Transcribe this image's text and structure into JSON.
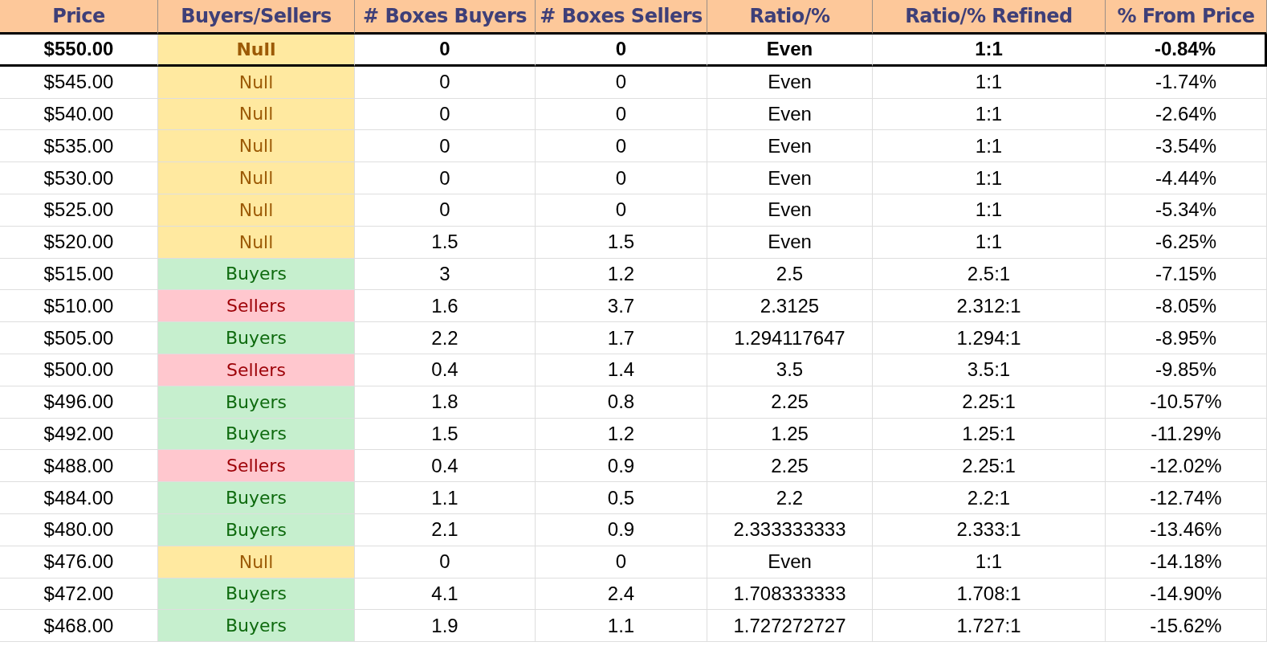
{
  "table": {
    "columns": [
      "Price",
      "Buyers/Sellers",
      "# Boxes Buyers",
      "# Boxes Sellers",
      "Ratio/%",
      "Ratio/% Refined",
      "% From Price"
    ],
    "rows": [
      {
        "current": true,
        "price": "$550.00",
        "side": {
          "text": "Null",
          "kind": "null"
        },
        "buyers": "0",
        "sellers": "0",
        "ratio": "Even",
        "refined": "1:1",
        "from_price": "-0.84%"
      },
      {
        "current": false,
        "price": "$545.00",
        "side": {
          "text": "Null",
          "kind": "null"
        },
        "buyers": "0",
        "sellers": "0",
        "ratio": "Even",
        "refined": "1:1",
        "from_price": "-1.74%"
      },
      {
        "current": false,
        "price": "$540.00",
        "side": {
          "text": "Null",
          "kind": "null"
        },
        "buyers": "0",
        "sellers": "0",
        "ratio": "Even",
        "refined": "1:1",
        "from_price": "-2.64%"
      },
      {
        "current": false,
        "price": "$535.00",
        "side": {
          "text": "Null",
          "kind": "null"
        },
        "buyers": "0",
        "sellers": "0",
        "ratio": "Even",
        "refined": "1:1",
        "from_price": "-3.54%"
      },
      {
        "current": false,
        "price": "$530.00",
        "side": {
          "text": "Null",
          "kind": "null"
        },
        "buyers": "0",
        "sellers": "0",
        "ratio": "Even",
        "refined": "1:1",
        "from_price": "-4.44%"
      },
      {
        "current": false,
        "price": "$525.00",
        "side": {
          "text": "Null",
          "kind": "null"
        },
        "buyers": "0",
        "sellers": "0",
        "ratio": "Even",
        "refined": "1:1",
        "from_price": "-5.34%"
      },
      {
        "current": false,
        "price": "$520.00",
        "side": {
          "text": "Null",
          "kind": "null"
        },
        "buyers": "1.5",
        "sellers": "1.5",
        "ratio": "Even",
        "refined": "1:1",
        "from_price": "-6.25%"
      },
      {
        "current": false,
        "price": "$515.00",
        "side": {
          "text": "Buyers",
          "kind": "buyers"
        },
        "buyers": "3",
        "sellers": "1.2",
        "ratio": "2.5",
        "refined": "2.5:1",
        "from_price": "-7.15%"
      },
      {
        "current": false,
        "price": "$510.00",
        "side": {
          "text": "Sellers",
          "kind": "sellers"
        },
        "buyers": "1.6",
        "sellers": "3.7",
        "ratio": "2.3125",
        "refined": "2.312:1",
        "from_price": "-8.05%"
      },
      {
        "current": false,
        "price": "$505.00",
        "side": {
          "text": "Buyers",
          "kind": "buyers"
        },
        "buyers": "2.2",
        "sellers": "1.7",
        "ratio": "1.294117647",
        "refined": "1.294:1",
        "from_price": "-8.95%"
      },
      {
        "current": false,
        "price": "$500.00",
        "side": {
          "text": "Sellers",
          "kind": "sellers"
        },
        "buyers": "0.4",
        "sellers": "1.4",
        "ratio": "3.5",
        "refined": "3.5:1",
        "from_price": "-9.85%"
      },
      {
        "current": false,
        "price": "$496.00",
        "side": {
          "text": "Buyers",
          "kind": "buyers"
        },
        "buyers": "1.8",
        "sellers": "0.8",
        "ratio": "2.25",
        "refined": "2.25:1",
        "from_price": "-10.57%"
      },
      {
        "current": false,
        "price": "$492.00",
        "side": {
          "text": "Buyers",
          "kind": "buyers"
        },
        "buyers": "1.5",
        "sellers": "1.2",
        "ratio": "1.25",
        "refined": "1.25:1",
        "from_price": "-11.29%"
      },
      {
        "current": false,
        "price": "$488.00",
        "side": {
          "text": "Sellers",
          "kind": "sellers"
        },
        "buyers": "0.4",
        "sellers": "0.9",
        "ratio": "2.25",
        "refined": "2.25:1",
        "from_price": "-12.02%"
      },
      {
        "current": false,
        "price": "$484.00",
        "side": {
          "text": "Buyers",
          "kind": "buyers"
        },
        "buyers": "1.1",
        "sellers": "0.5",
        "ratio": "2.2",
        "refined": "2.2:1",
        "from_price": "-12.74%"
      },
      {
        "current": false,
        "price": "$480.00",
        "side": {
          "text": "Buyers",
          "kind": "buyers"
        },
        "buyers": "2.1",
        "sellers": "0.9",
        "ratio": "2.333333333",
        "refined": "2.333:1",
        "from_price": "-13.46%"
      },
      {
        "current": false,
        "price": "$476.00",
        "side": {
          "text": "Null",
          "kind": "null"
        },
        "buyers": "0",
        "sellers": "0",
        "ratio": "Even",
        "refined": "1:1",
        "from_price": "-14.18%"
      },
      {
        "current": false,
        "price": "$472.00",
        "side": {
          "text": "Buyers",
          "kind": "buyers"
        },
        "buyers": "4.1",
        "sellers": "2.4",
        "ratio": "1.708333333",
        "refined": "1.708:1",
        "from_price": "-14.90%"
      },
      {
        "current": false,
        "price": "$468.00",
        "side": {
          "text": "Buyers",
          "kind": "buyers"
        },
        "buyers": "1.9",
        "sellers": "1.1",
        "ratio": "1.727272727",
        "refined": "1.727:1",
        "from_price": "-15.62%"
      }
    ]
  }
}
